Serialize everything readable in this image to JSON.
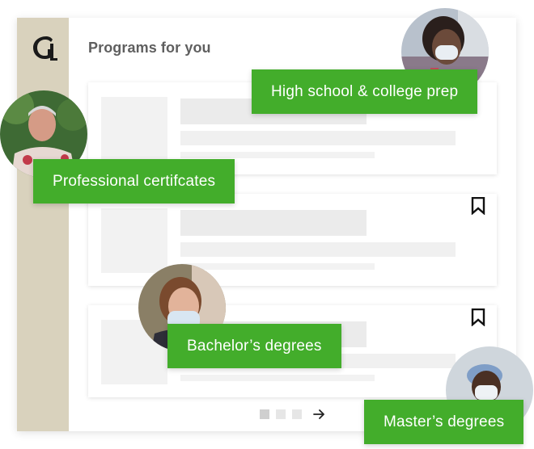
{
  "page": {
    "title": "Programs for you"
  },
  "tags": {
    "high_school": "High school & college prep",
    "professional": "Professional certifcates",
    "bachelors": "Bachelor’s degrees",
    "masters": "Master’s degrees"
  },
  "icons": {
    "logo": "g-monogram-logo",
    "bookmark": "bookmark-icon",
    "next": "arrow-right-icon"
  },
  "pagination": {
    "pages": 3,
    "current": 1
  },
  "colors": {
    "accent_green": "#43ad2b",
    "sidebar": "#d9d2bd",
    "title_text": "#5f5f5f",
    "placeholder": "#ebebeb"
  }
}
